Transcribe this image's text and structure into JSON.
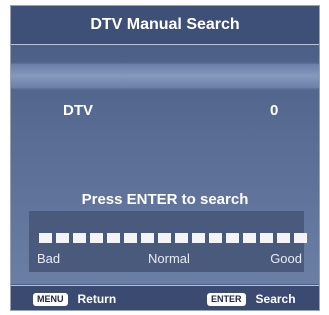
{
  "header": {
    "title": "DTV Manual Search"
  },
  "channel": {
    "label": "DTV",
    "value": "0"
  },
  "prompt": "Press ENTER to search",
  "signal": {
    "segments": 16,
    "labels": {
      "bad": "Bad",
      "normal": "Normal",
      "good": "Good"
    }
  },
  "footer": {
    "menu_key": "MENU",
    "menu_action": "Return",
    "enter_key": "ENTER",
    "enter_action": "Search"
  },
  "colors": {
    "background": "#4b5f87",
    "header": "#3f5078",
    "text": "#ffffff"
  }
}
